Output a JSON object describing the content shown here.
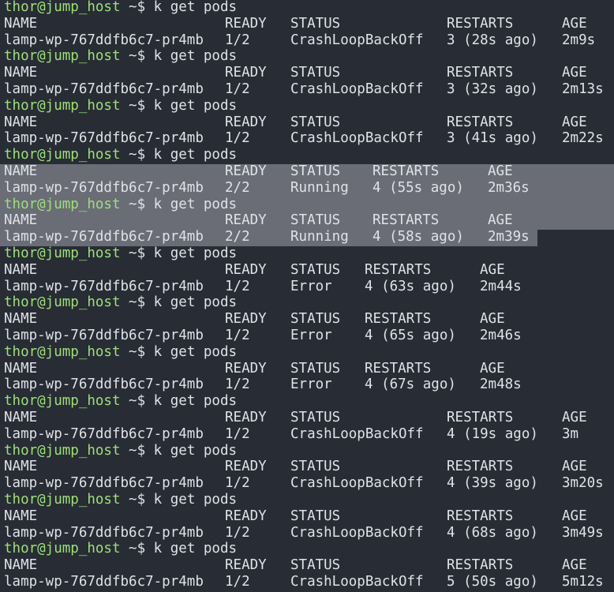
{
  "terminal": {
    "prompt_user": "thor@jump_host",
    "prompt_symbol": " ~$ ",
    "command": "k get pods",
    "colors": {
      "background": "#282c34",
      "foreground": "#dfe2e8",
      "prompt": "#9de07a",
      "selection": "#6a6d76"
    },
    "outputs": [
      {
        "header": [
          "NAME",
          "READY",
          "STATUS",
          "RESTARTS",
          "AGE"
        ],
        "row": [
          "lamp-wp-767ddfb6c7-pr4mb",
          "1/2",
          "CrashLoopBackOff",
          "3 (28s ago)",
          "2m9s"
        ],
        "layout": "wide",
        "has_prompt": false
      },
      {
        "header": [
          "NAME",
          "READY",
          "STATUS",
          "RESTARTS",
          "AGE"
        ],
        "row": [
          "lamp-wp-767ddfb6c7-pr4mb",
          "1/2",
          "CrashLoopBackOff",
          "3 (32s ago)",
          "2m13s"
        ],
        "layout": "wide",
        "has_prompt": true
      },
      {
        "header": [
          "NAME",
          "READY",
          "STATUS",
          "RESTARTS",
          "AGE"
        ],
        "row": [
          "lamp-wp-767ddfb6c7-pr4mb",
          "1/2",
          "CrashLoopBackOff",
          "3 (41s ago)",
          "2m22s"
        ],
        "layout": "wide",
        "has_prompt": true
      },
      {
        "header": [
          "NAME",
          "READY",
          "STATUS",
          "RESTARTS",
          "AGE"
        ],
        "row": [
          "lamp-wp-767ddfb6c7-pr4mb",
          "2/2",
          "Running",
          "4 (55s ago)",
          "2m36s"
        ],
        "layout": "running",
        "has_prompt": true
      },
      {
        "header": [
          "NAME",
          "READY",
          "STATUS",
          "RESTARTS",
          "AGE"
        ],
        "row": [
          "lamp-wp-767ddfb6c7-pr4mb",
          "2/2",
          "Running",
          "4 (58s ago)",
          "2m39s"
        ],
        "layout": "running",
        "has_prompt": true
      },
      {
        "header": [
          "NAME",
          "READY",
          "STATUS",
          "RESTARTS",
          "AGE"
        ],
        "row": [
          "lamp-wp-767ddfb6c7-pr4mb",
          "1/2",
          "Error",
          "4 (63s ago)",
          "2m44s"
        ],
        "layout": "error",
        "has_prompt": true
      },
      {
        "header": [
          "NAME",
          "READY",
          "STATUS",
          "RESTARTS",
          "AGE"
        ],
        "row": [
          "lamp-wp-767ddfb6c7-pr4mb",
          "1/2",
          "Error",
          "4 (65s ago)",
          "2m46s"
        ],
        "layout": "error",
        "has_prompt": true
      },
      {
        "header": [
          "NAME",
          "READY",
          "STATUS",
          "RESTARTS",
          "AGE"
        ],
        "row": [
          "lamp-wp-767ddfb6c7-pr4mb",
          "1/2",
          "Error",
          "4 (67s ago)",
          "2m48s"
        ],
        "layout": "error",
        "has_prompt": true
      },
      {
        "header": [
          "NAME",
          "READY",
          "STATUS",
          "RESTARTS",
          "AGE"
        ],
        "row": [
          "lamp-wp-767ddfb6c7-pr4mb",
          "1/2",
          "CrashLoopBackOff",
          "4 (19s ago)",
          "3m"
        ],
        "layout": "wide",
        "has_prompt": true
      },
      {
        "header": [
          "NAME",
          "READY",
          "STATUS",
          "RESTARTS",
          "AGE"
        ],
        "row": [
          "lamp-wp-767ddfb6c7-pr4mb",
          "1/2",
          "CrashLoopBackOff",
          "4 (39s ago)",
          "3m20s"
        ],
        "layout": "wide",
        "has_prompt": true
      },
      {
        "header": [
          "NAME",
          "READY",
          "STATUS",
          "RESTARTS",
          "AGE"
        ],
        "row": [
          "lamp-wp-767ddfb6c7-pr4mb",
          "1/2",
          "CrashLoopBackOff",
          "4 (68s ago)",
          "3m49s"
        ],
        "layout": "wide",
        "has_prompt": true
      },
      {
        "header": [
          "NAME",
          "READY",
          "STATUS",
          "RESTARTS",
          "AGE"
        ],
        "row": [
          "lamp-wp-767ddfb6c7-pr4mb",
          "1/2",
          "CrashLoopBackOff",
          "5 (50s ago)",
          "5m12s"
        ],
        "layout": "wide",
        "has_prompt": true
      }
    ]
  }
}
